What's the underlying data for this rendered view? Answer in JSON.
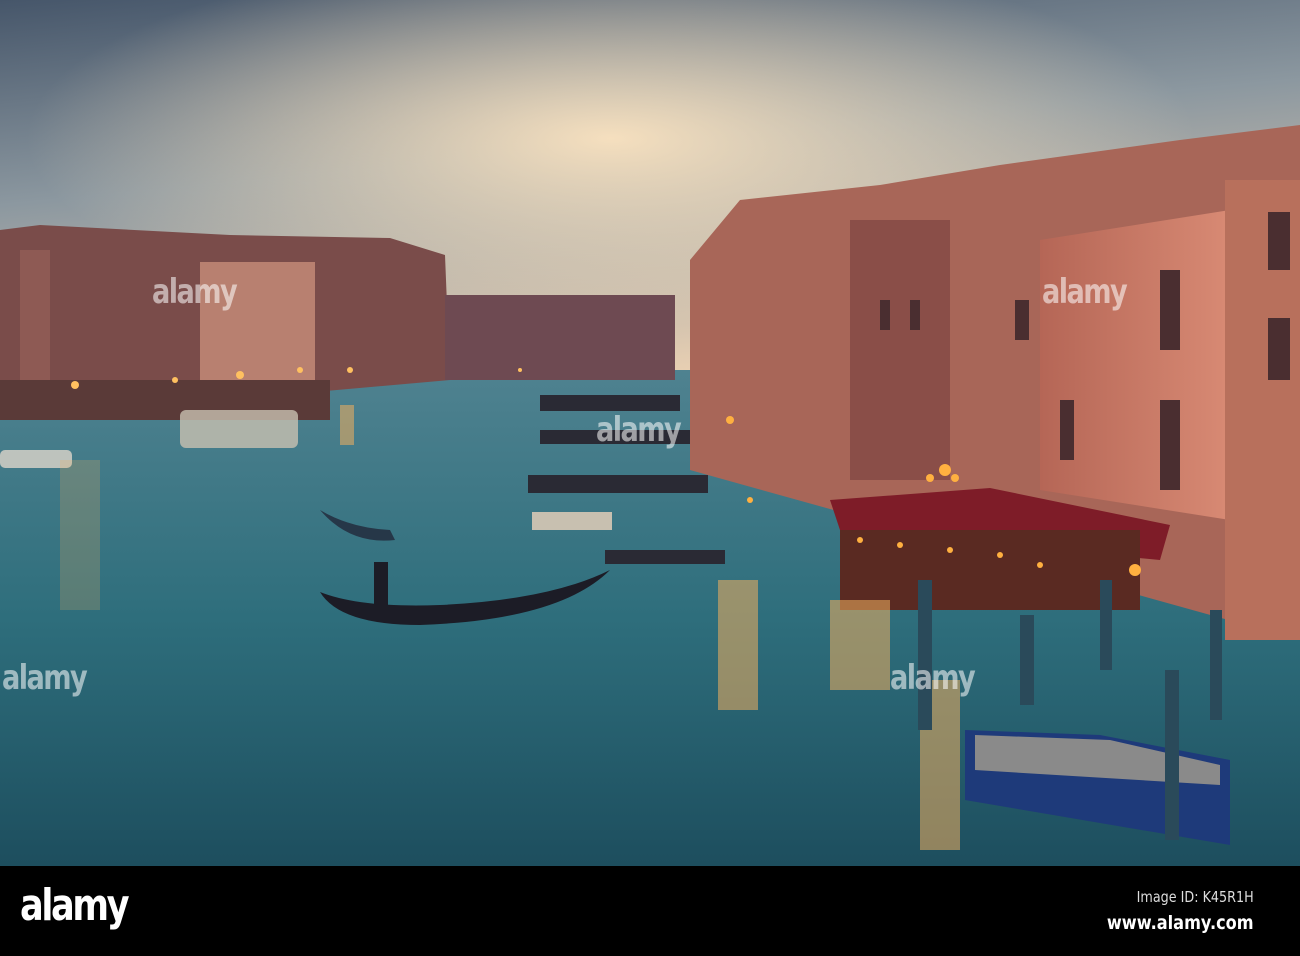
{
  "photo": {
    "subject": "Grand Canal at dusk",
    "colors": {
      "sky_top": "#4b5a6b",
      "sky_glow": "#f2d9b8",
      "water": "#2f6f7e",
      "water_dark": "#1a4150",
      "lights": "#ffb347",
      "awning": "#8a1e2a"
    }
  },
  "watermark": {
    "text": "alamy"
  },
  "footer": {
    "logo": "alamy",
    "image_id": "Image ID: K45R1H",
    "url": "www.alamy.com"
  }
}
